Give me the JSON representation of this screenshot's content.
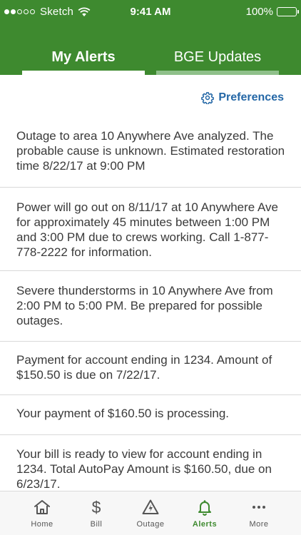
{
  "status_bar": {
    "carrier": "Sketch",
    "time": "9:41 AM",
    "battery": "100%",
    "signal_icon": "cellular-signal-icon",
    "wifi_icon": "wifi-icon",
    "battery_icon": "battery-full-icon"
  },
  "tabs": [
    {
      "label": "My Alerts",
      "active": true
    },
    {
      "label": "BGE Updates",
      "active": false
    }
  ],
  "preferences": {
    "label": "Preferences",
    "icon": "gear-icon"
  },
  "alerts": [
    {
      "text": "Outage to area 10 Anywhere Ave analyzed. The probable cause is unknown. Estimated restoration time 8/22/17 at 9:00 PM"
    },
    {
      "text": "Power will go out on 8/11/17 at 10 Anywhere Ave for approximately 45 minutes between 1:00 PM and 3:00 PM due to crews working. Call 1-877-778-2222 for information."
    },
    {
      "text": "Severe thunderstorms in 10 Anywhere Ave from 2:00 PM to 5:00 PM. Be prepared for possible outages."
    },
    {
      "text": "Payment for account ending in 1234. Amount of $150.50 is due on 7/22/17."
    },
    {
      "text": "Your payment of $160.50 is processing."
    },
    {
      "text": "Your bill is ready to view for account ending in 1234. Total AutoPay Amount is $160.50, due on 6/23/17."
    }
  ],
  "bottom_nav": [
    {
      "label": "Home",
      "icon": "home-icon",
      "active": false
    },
    {
      "label": "Bill",
      "icon": "dollar-icon",
      "active": false
    },
    {
      "label": "Outage",
      "icon": "outage-bolt-icon",
      "active": false
    },
    {
      "label": "Alerts",
      "icon": "bell-icon",
      "active": true
    },
    {
      "label": "More",
      "icon": "more-dots-icon",
      "active": false
    }
  ],
  "colors": {
    "brand_green": "#3e8a2f",
    "link_blue": "#2467a6",
    "text": "#3a3a3a"
  }
}
